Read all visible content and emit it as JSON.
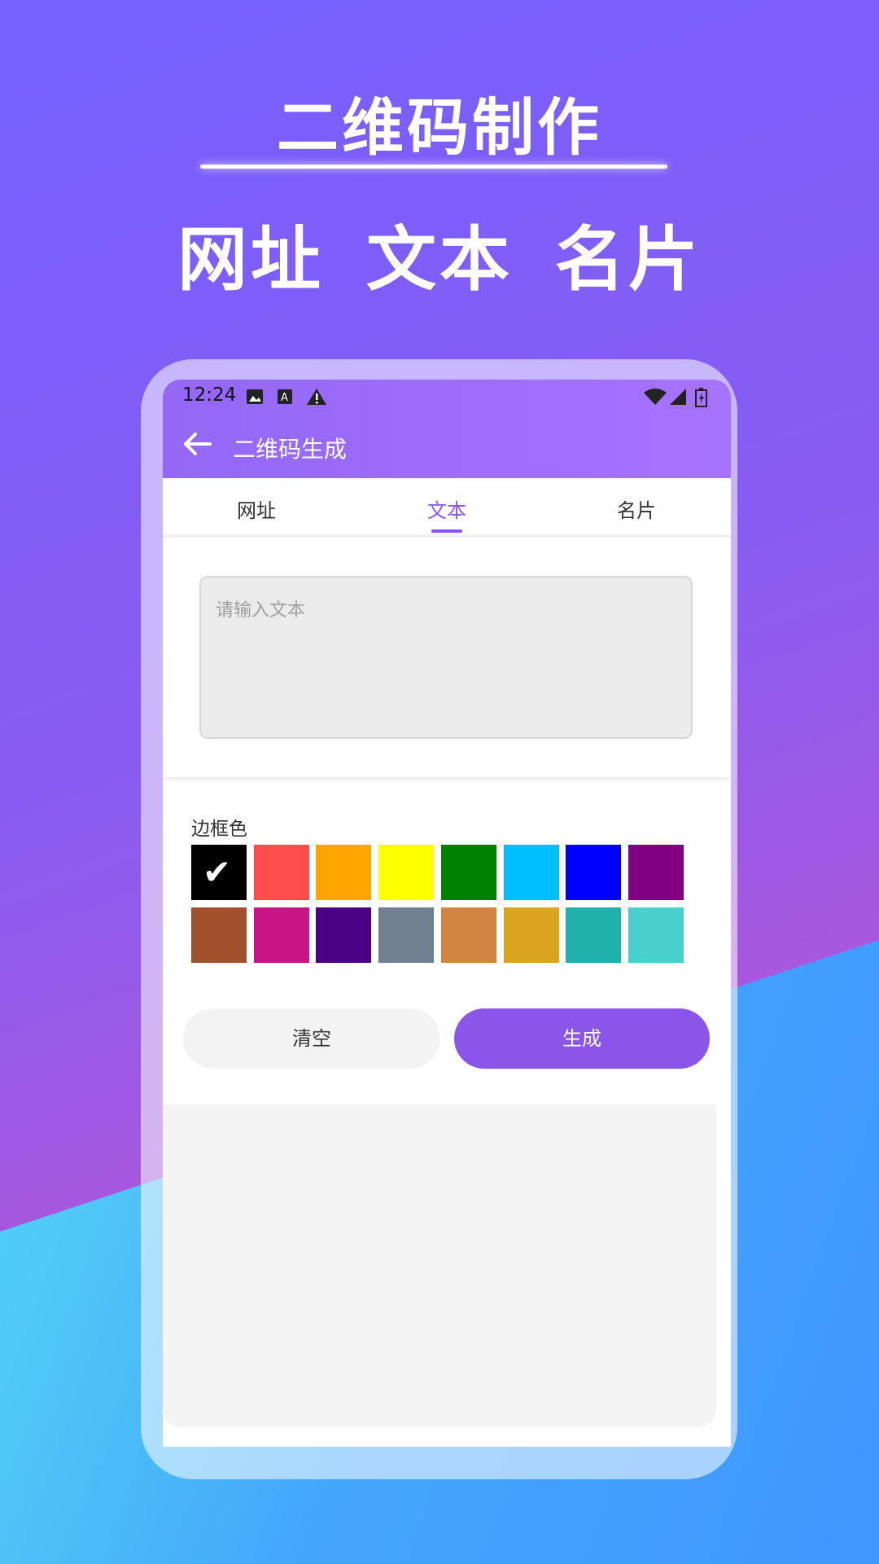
{
  "hero": {
    "title": "二维码制作",
    "subtitle": "网址 文本 名片"
  },
  "status_bar": {
    "time": "12:24",
    "icons": [
      "image-icon",
      "text-a-icon",
      "warning-icon",
      "wifi-icon",
      "signal-icon",
      "battery-icon"
    ]
  },
  "appbar": {
    "title": "二维码生成",
    "back_icon": "arrow-left-icon"
  },
  "tabs": [
    {
      "label": "网址",
      "active": false
    },
    {
      "label": "文本",
      "active": true
    },
    {
      "label": "名片",
      "active": false
    }
  ],
  "text_input": {
    "placeholder": "请输入文本",
    "value": ""
  },
  "border_color": {
    "label": "边框色",
    "selected_index": 0,
    "colors": [
      "#000000",
      "#ff4d4d",
      "#ffa500",
      "#ffff00",
      "#008000",
      "#00bfff",
      "#0000ff",
      "#800080",
      "#a0522d",
      "#c71585",
      "#4b0082",
      "#708090",
      "#cd853f",
      "#daa520",
      "#20b2aa",
      "#48d1cc"
    ]
  },
  "buttons": {
    "clear": "清空",
    "generate": "生成"
  },
  "colors": {
    "accent": "#8a55f0",
    "appbar": "#a06cff"
  }
}
